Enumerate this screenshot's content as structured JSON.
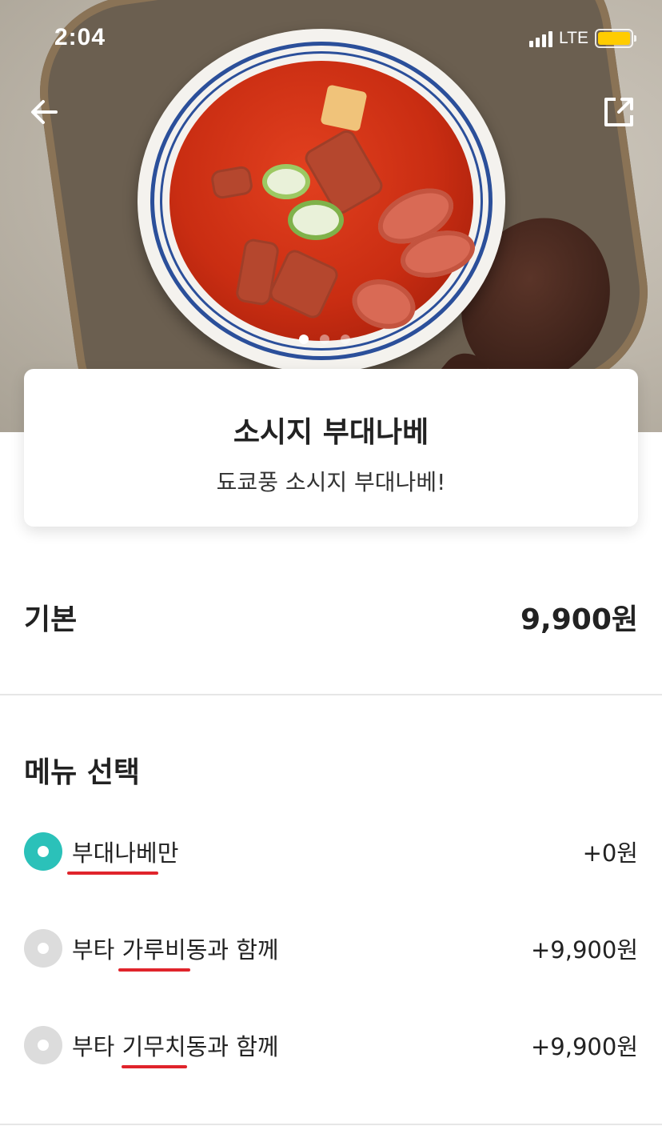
{
  "status_bar": {
    "time": "2:04",
    "network": "LTE"
  },
  "menu": {
    "title": "소시지 부대나베",
    "description": "됴쿄풍 소시지 부대나베!"
  },
  "base_price": {
    "label": "기본",
    "value": "9,900원"
  },
  "menu_select": {
    "title": "메뉴 선택",
    "options": [
      {
        "label": "부대나베만",
        "price": "+0원",
        "selected": true
      },
      {
        "label": "부타 가루비동과 함께",
        "price": "+9,900원",
        "selected": false
      },
      {
        "label": "부타 기무치동과 함께",
        "price": "+9,900원",
        "selected": false
      }
    ]
  },
  "carousel": {
    "page_count": 3,
    "active_index": 0
  },
  "colors": {
    "accent": "#2bc1b9",
    "battery": "#ffcc00",
    "annotation": "#e0242b"
  },
  "icons": {
    "back": "arrow-left-icon",
    "share": "share-icon"
  }
}
